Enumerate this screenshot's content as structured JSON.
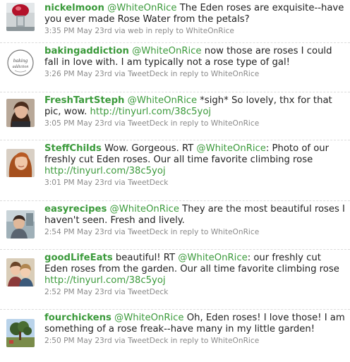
{
  "tweets": [
    {
      "user": "nickelmoon",
      "avatar_icon": "red-object-photo-icon",
      "parts": [
        {
          "t": "mention",
          "v": "@WhiteOnRice"
        },
        {
          "t": "text",
          "v": " The Eden roses are exquisite--have you ever made Rose Water from the petals?"
        }
      ],
      "time": "3:35 PM May 23rd",
      "via": " via web",
      "reply": "in reply to WhiteOnRice"
    },
    {
      "user": "bakingaddiction",
      "avatar_icon": "baking-addiction-logo-icon",
      "avatar_text_1": "baking",
      "avatar_text_2": "addiction",
      "parts": [
        {
          "t": "mention",
          "v": "@WhiteOnRice"
        },
        {
          "t": "text",
          "v": " now those are roses I could fall in love with. I am typically not a rose type of gal!"
        }
      ],
      "time": "3:26 PM May 23rd",
      "via": " via TweetDeck",
      "reply": "in reply to WhiteOnRice"
    },
    {
      "user": "FreshTartSteph",
      "avatar_icon": "woman-portrait-icon",
      "parts": [
        {
          "t": "mention",
          "v": "@WhiteOnRice"
        },
        {
          "t": "text",
          "v": " *sigh* So lovely, thx for that pic, wow. "
        },
        {
          "t": "link",
          "v": "http://tinyurl.com/38c5yoj"
        }
      ],
      "time": "3:05 PM May 23rd",
      "via": " via TweetDeck",
      "reply": "in reply to WhiteOnRice"
    },
    {
      "user": "SteffChilds",
      "avatar_icon": "woman-red-hair-portrait-icon",
      "parts": [
        {
          "t": "text",
          "v": " Wow. Gorgeous. RT "
        },
        {
          "t": "mention",
          "v": "@WhiteOnRice"
        },
        {
          "t": "text",
          "v": ": Photo of our freshly cut Eden roses. Our all time favorite climbing rose "
        },
        {
          "t": "link",
          "v": "http://tinyurl.com/38c5yoj"
        }
      ],
      "time": "3:01 PM May 23rd",
      "via": " via TweetDeck",
      "reply": ""
    },
    {
      "user": "easyrecipes",
      "avatar_icon": "child-photo-icon",
      "parts": [
        {
          "t": "mention",
          "v": "@WhiteOnRice"
        },
        {
          "t": "text",
          "v": " They are the most beautiful roses I haven't seen. Fresh and lively."
        }
      ],
      "time": "2:54 PM May 23rd",
      "via": " via TweetDeck",
      "reply": "in reply to WhiteOnRice"
    },
    {
      "user": "goodLifeEats",
      "avatar_icon": "two-people-portrait-icon",
      "parts": [
        {
          "t": "text",
          "v": " beautiful! RT "
        },
        {
          "t": "mention",
          "v": "@WhiteOnRice"
        },
        {
          "t": "text",
          "v": ": our freshly cut Eden roses from the garden. Our all time favorite climbing rose "
        },
        {
          "t": "link",
          "v": "http://tinyurl.com/38c5yoj"
        }
      ],
      "time": "2:52 PM May 23rd",
      "via": " via TweetDeck",
      "reply": ""
    },
    {
      "user": "fourchickens",
      "avatar_icon": "tree-landscape-icon",
      "parts": [
        {
          "t": "mention",
          "v": "@WhiteOnRice"
        },
        {
          "t": "text",
          "v": " Oh, Eden roses! I love those! I am something of a rose freak--have many in my little garden!"
        }
      ],
      "time": "2:50 PM May 23rd",
      "via": " via TweetDeck",
      "reply": "in reply to WhiteOnRice"
    }
  ]
}
